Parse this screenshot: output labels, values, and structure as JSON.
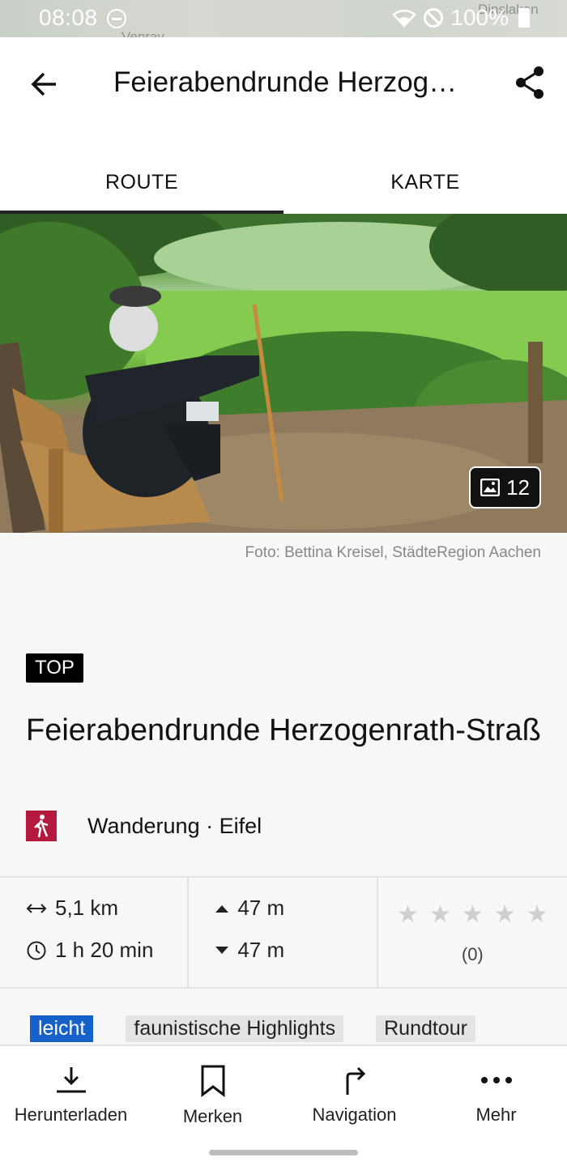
{
  "status_bar": {
    "time": "08:08",
    "battery": "100%",
    "map_labels": [
      "Venray",
      "Dinslaken"
    ]
  },
  "app_bar": {
    "title": "Feierabendrunde Herzogenrath-Straß",
    "back_icon": "arrow-left-icon",
    "share_icon": "share-icon"
  },
  "tabs": [
    {
      "label": "ROUTE",
      "active": true
    },
    {
      "label": "KARTE",
      "active": false
    }
  ],
  "hero": {
    "photo_count": "12",
    "caption": "Foto: Bettina Kreisel, StädteRegion Aachen"
  },
  "route": {
    "badge": "TOP",
    "title": "Feierabendrunde Herzogenrath-Straß",
    "category": "Wanderung · Eifel",
    "category_color": "#b5193d"
  },
  "stats": {
    "distance": "5,1 km",
    "duration": "1 h 20 min",
    "ascent": "47 m",
    "descent": "47 m",
    "rating_count": "(0)",
    "rating_stars": 0,
    "rating_max": 5
  },
  "tags": [
    {
      "label": "leicht",
      "type": "level",
      "color": "#1660c9"
    },
    {
      "label": "faunistische Highlights",
      "type": "tag"
    },
    {
      "label": "Rundtour",
      "type": "tag"
    }
  ],
  "bottom_nav": [
    {
      "label": "Herunterladen",
      "icon": "download-icon"
    },
    {
      "label": "Merken",
      "icon": "bookmark-icon"
    },
    {
      "label": "Navigation",
      "icon": "turn-right-icon"
    },
    {
      "label": "Mehr",
      "icon": "more-icon"
    }
  ]
}
